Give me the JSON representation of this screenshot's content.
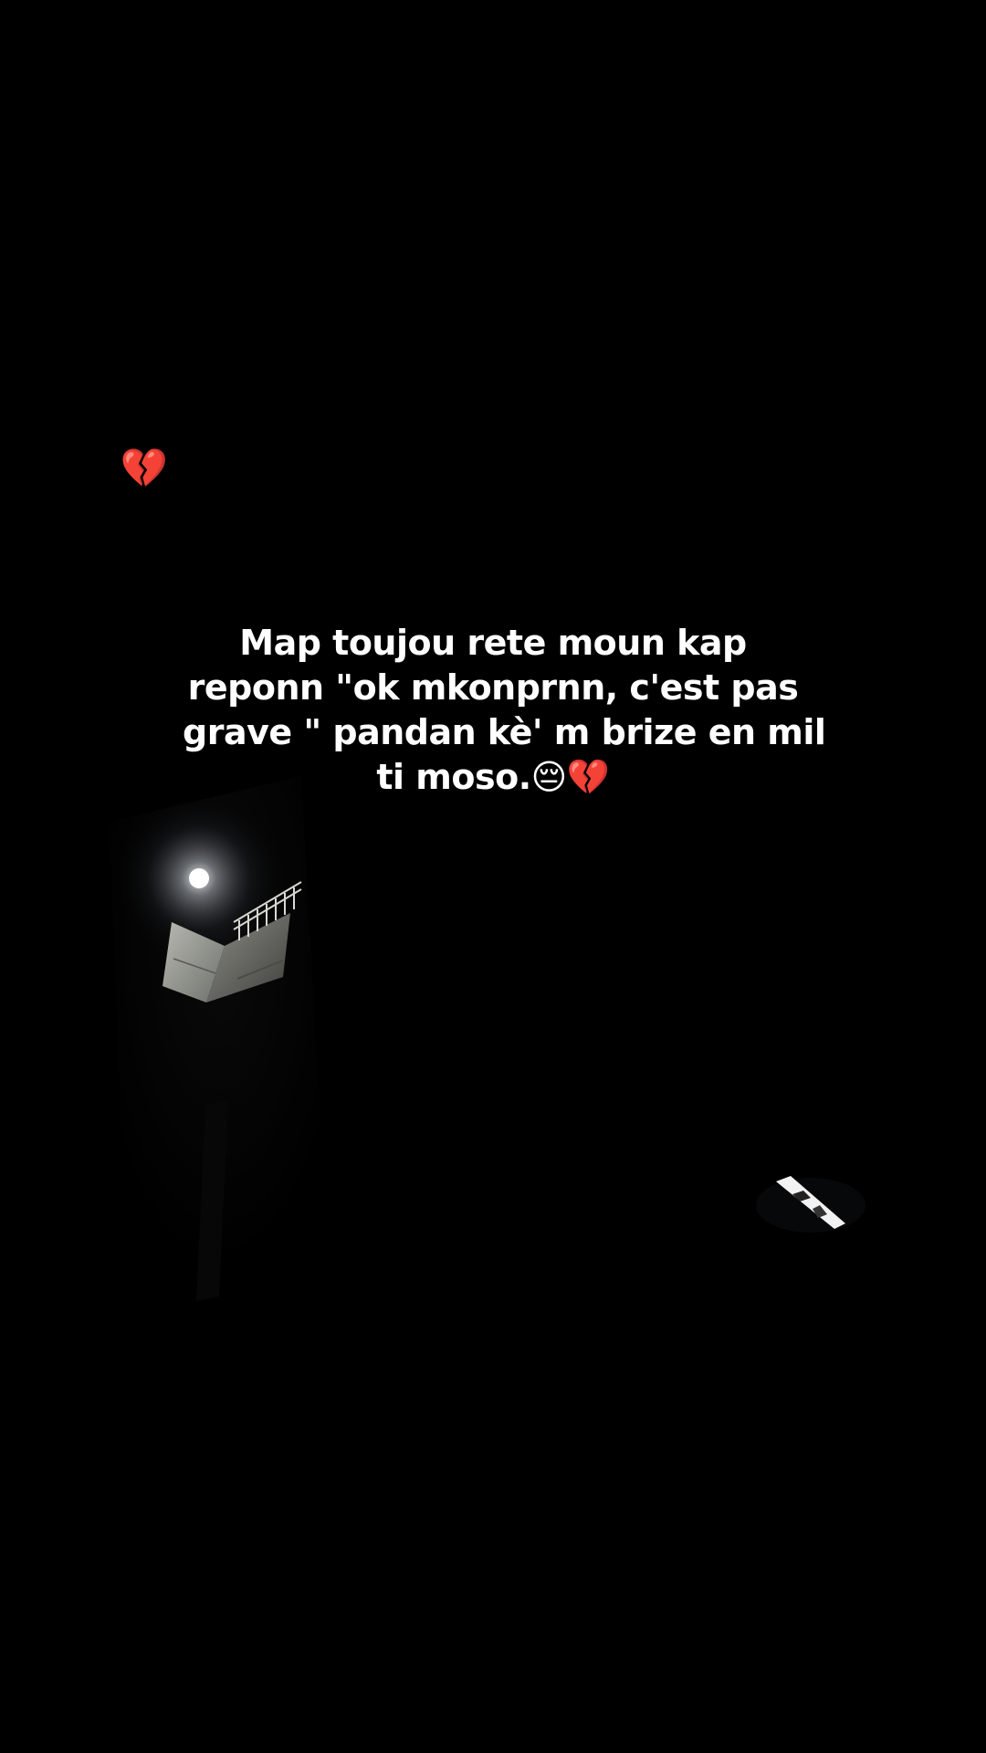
{
  "top_emojis": [
    "😖",
    "💔"
  ],
  "caption": {
    "lines": [
      "Map toujou rete moun kap",
      "reponn \"ok mkonprnn, c'est pas",
      "grave \" pandan kè' m brize en mil",
      "ti moso."
    ],
    "trailing_emojis": [
      "😔",
      "💔"
    ]
  },
  "colors": {
    "background": "#000000",
    "text": "#ffffff",
    "lamp": "#ffffff",
    "wall": "#c9c9c4"
  }
}
